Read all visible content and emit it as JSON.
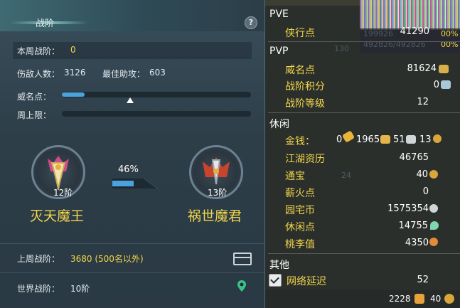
{
  "left": {
    "title": "战阶",
    "help": "?",
    "weekly_label": "本周战阶：",
    "weekly_value": "0",
    "kills_label": "伤敌人数：",
    "kills_value": "3126",
    "assist_label": "最佳助攻：",
    "assist_value": "603",
    "fame_label": "威名点：",
    "fame_progress": 0.12,
    "weekly_limit_label": "周上限：",
    "weekly_limit_progress": 0,
    "current_rank": {
      "rank": "12阶",
      "name": "灭天魔王"
    },
    "progress_percent": "46%",
    "progress_fraction": 0.46,
    "next_rank": {
      "rank": "13阶",
      "name": "祸世魔君"
    },
    "last_week_label": "上周战阶：",
    "last_week_value": "3680 (500名以外)",
    "world_label": "世界战阶：",
    "world_value": "10阶"
  },
  "right": {
    "pve": {
      "header": "PVE",
      "rows": [
        {
          "label": "侠行点",
          "value": "41290"
        }
      ]
    },
    "pvp": {
      "header": "PVP",
      "rows": [
        {
          "label": "威名点",
          "value": "81624"
        },
        {
          "label": "战阶积分",
          "value": "0"
        },
        {
          "label": "战阶等级",
          "value": "12"
        }
      ]
    },
    "leisure": {
      "header": "休闲",
      "money_label": "金钱：",
      "money_gold": "0",
      "money_silver": "1965",
      "money_copper": "51",
      "money_other": "13",
      "rows": [
        {
          "label": "江湖资历",
          "value": "46765"
        },
        {
          "label": "通宝",
          "value": "40"
        },
        {
          "label": "薪火点",
          "value": "0"
        },
        {
          "label": "园宅币",
          "value": "1575354"
        },
        {
          "label": "休闲点",
          "value": "14755"
        },
        {
          "label": "桃李值",
          "value": "4350"
        }
      ]
    },
    "other": {
      "header": "其他",
      "latency_label": "网络延迟",
      "latency_value": "52",
      "latency_checked": true
    },
    "bottom": {
      "value_a": "2228",
      "value_b": "40"
    },
    "background_numbers": {
      "a": "199926",
      "b": "492826/492826",
      "c": "130",
      "d": "24",
      "e": "00%",
      "f": "00%"
    }
  },
  "colors": {
    "gold": "#f2d64b",
    "progress": "#4aa3dd",
    "panel": "#2d3e48"
  }
}
